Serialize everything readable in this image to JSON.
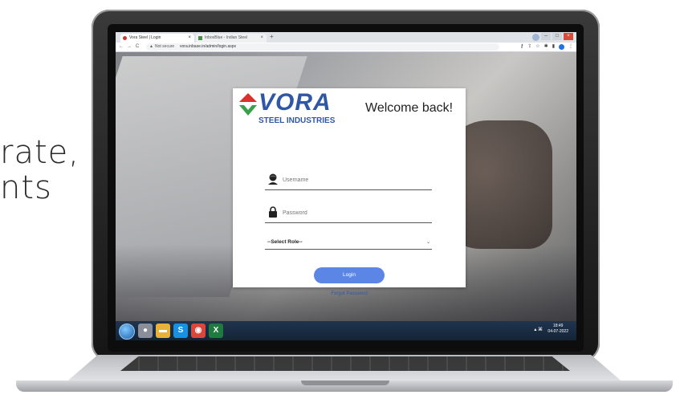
{
  "background_text": {
    "line1": "rate,",
    "line2": "nts"
  },
  "browser": {
    "tabs": [
      {
        "title": "Vora Steel | Login",
        "close": "×"
      },
      {
        "title": "InboxBlue - Indian Steel",
        "close": "×"
      }
    ],
    "new_tab": "+",
    "nav": {
      "back": "←",
      "forward": "→",
      "reload": "C"
    },
    "address": {
      "security_icon": "warning-icon",
      "not_secure": "Not secure",
      "url": "vora.inbase.in/admin/login.aspx"
    },
    "toolbar_icons": [
      "key-icon",
      "share-icon",
      "star-icon",
      "extension-icon",
      "sidepanel-icon",
      "profile-icon",
      "menu-icon"
    ],
    "window_controls": {
      "minimize": "–",
      "maximize": "□",
      "close": "×"
    }
  },
  "login": {
    "brand": "VORA",
    "tagline": "STEEL INDUSTRIES",
    "welcome": "Welcome back!",
    "username_placeholder": "Username",
    "password_placeholder": "Password",
    "role_select": "--Select Role--",
    "login_label": "Login",
    "forgot_label": "Forgot Password"
  },
  "taskbar": {
    "apps": [
      "chrome-like",
      "folder",
      "skype",
      "chrome",
      "excel"
    ],
    "time": "18:49",
    "date": "04-07-2022"
  },
  "colors": {
    "brand_blue": "#2f57a6",
    "brand_red": "#d8322a",
    "brand_green": "#3aa14a",
    "button_blue": "#5b86e5"
  }
}
